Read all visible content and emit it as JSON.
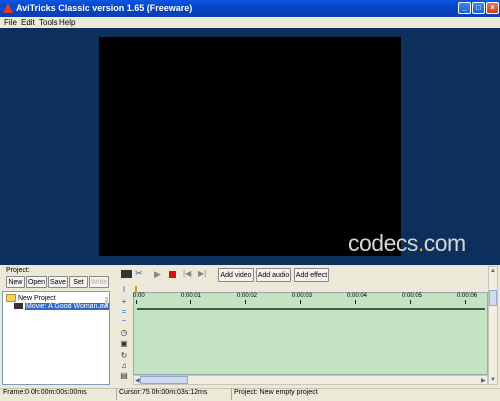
{
  "window": {
    "title": "AviTricks Classic version 1.65 (Freeware)"
  },
  "menu": {
    "items": [
      "File",
      "Edit",
      "Tools",
      "Help"
    ]
  },
  "watermark": {
    "text_a": "codecs",
    "text_dot": ".",
    "text_b": "com"
  },
  "project": {
    "label": "Project:",
    "buttons": [
      "New",
      "Open",
      "Save",
      "Set",
      "Write"
    ],
    "tree_root": "New Project",
    "tree_item": "Movie: A Good Woman.avi"
  },
  "toolbar": {
    "add_video": "Add video",
    "add_audio": "Add audio",
    "add_effect": "Add effect"
  },
  "timeline": {
    "ruler": [
      "0:00",
      "0:00:01",
      "0:00:02",
      "0:00:03",
      "0:00:04",
      "0:00:05",
      "0:00:06"
    ]
  },
  "status": {
    "frame": "Frame:0   0h:00m:00s:00ms",
    "cursor": "Cursor:75   0h:00m:03s:12ms",
    "project": "Project: New empty project"
  }
}
